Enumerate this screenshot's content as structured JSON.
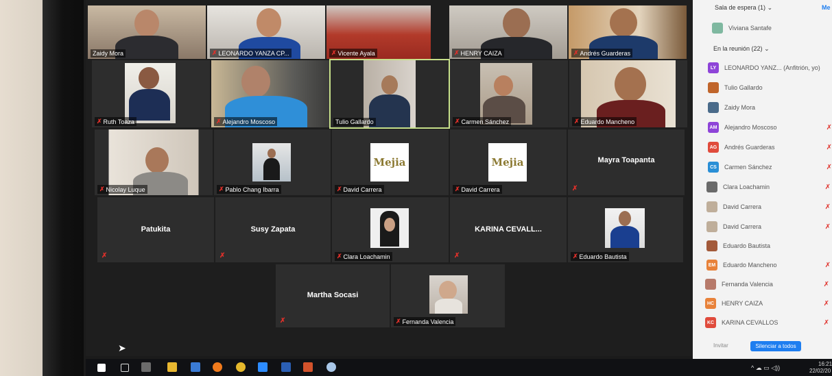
{
  "grid": {
    "row1": [
      {
        "name": "Zaidy Mora",
        "muted": false
      },
      {
        "name": "LEONARDO YANZA CP...",
        "muted": true
      },
      {
        "name": "Vicente Ayala",
        "muted": true
      },
      {
        "name": "HENRY CAIZA",
        "muted": true
      },
      {
        "name": "Andrés Guarderas",
        "muted": true
      }
    ],
    "row2": [
      {
        "name": "Ruth Toaza",
        "muted": true
      },
      {
        "name": "Alejandro Moscoso",
        "muted": true
      },
      {
        "name": "Tulio Gallardo",
        "muted": false
      },
      {
        "name": "Carmen Sánchez",
        "muted": true
      },
      {
        "name": "Eduardo Mancheno",
        "muted": true
      }
    ],
    "row3": [
      {
        "name": "Nicolay Luque",
        "muted": true
      },
      {
        "name": "Pablo Chang Ibarra",
        "muted": true
      },
      {
        "name": "David Carrera",
        "muted": true,
        "logo": "Mejia"
      },
      {
        "name": "David Carrera",
        "muted": true,
        "logo": "Mejia"
      },
      {
        "name": "Mayra Toapanta",
        "muted": true
      }
    ],
    "row4": [
      {
        "name": "Patukita",
        "muted": true
      },
      {
        "name": "Susy Zapata",
        "muted": true
      },
      {
        "name": "Clara Loachamin",
        "muted": true
      },
      {
        "name": "KARINA CEVALL...",
        "muted": true
      },
      {
        "name": "Eduardo Bautista",
        "muted": true
      }
    ],
    "row5": [
      {
        "name": "Martha Socasi",
        "muted": true
      },
      {
        "name": "Fernanda Valencia",
        "muted": true
      }
    ]
  },
  "panel": {
    "waiting_label": "Sala de espera (1)",
    "waiting_person": "Viviana Santafe",
    "top_right": "Me",
    "in_meeting_label": "En la reunión (22)",
    "participants": [
      {
        "initials": "LY",
        "color": "#8e44d8",
        "name": "LEONARDO YANZ... (Anfitrión, yo)"
      },
      {
        "initials": "",
        "color": "#c0652b",
        "name": "Tulio Gallardo"
      },
      {
        "initials": "",
        "color": "#4a6b8a",
        "name": "Zaidy Mora"
      },
      {
        "initials": "AM",
        "color": "#8e44d8",
        "name": "Alejandro Moscoso"
      },
      {
        "initials": "AG",
        "color": "#e04b3c",
        "name": "Andrés Guarderas"
      },
      {
        "initials": "CS",
        "color": "#2a8fd6",
        "name": "Carmen Sánchez"
      },
      {
        "initials": "",
        "color": "#6a6a6a",
        "name": "Clara Loachamin"
      },
      {
        "initials": "",
        "color": "#bfae9a",
        "name": "David Carrera"
      },
      {
        "initials": "",
        "color": "#bfae9a",
        "name": "David Carrera"
      },
      {
        "initials": "",
        "color": "#a35a3a",
        "name": "Eduardo Bautista"
      },
      {
        "initials": "EM",
        "color": "#e8823a",
        "name": "Eduardo Mancheno"
      },
      {
        "initials": "",
        "color": "#b77a6a",
        "name": "Fernanda Valencia"
      },
      {
        "initials": "HC",
        "color": "#e8823a",
        "name": "HENRY CAIZA"
      },
      {
        "initials": "KC",
        "color": "#e04b3c",
        "name": "KARINA CEVALLOS"
      }
    ],
    "invite_label": "Invitar",
    "mute_all_label": "Silenciar a todos"
  },
  "taskbar": {
    "time": "16:21",
    "date": "22/02/20"
  }
}
